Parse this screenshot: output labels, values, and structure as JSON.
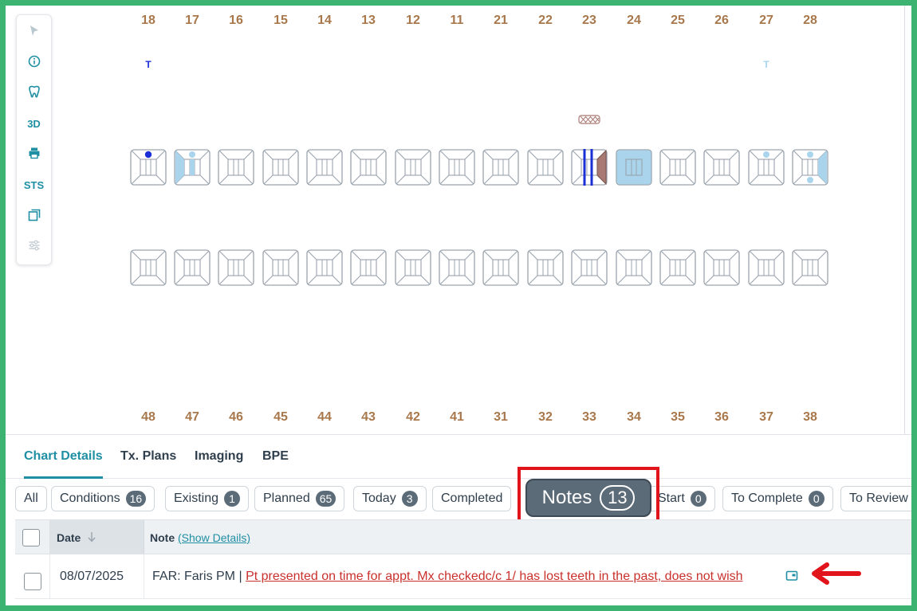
{
  "toolbar": {
    "items": [
      {
        "icon": "pointer-icon",
        "label": ""
      },
      {
        "icon": "info-icon",
        "label": ""
      },
      {
        "icon": "tooth-icon",
        "label": ""
      },
      {
        "icon": "3d-icon",
        "label": "3D"
      },
      {
        "icon": "print-icon",
        "label": ""
      },
      {
        "icon": "sts-icon",
        "label": "STS"
      },
      {
        "icon": "copy-icon",
        "label": ""
      },
      {
        "icon": "sliders-icon",
        "label": ""
      }
    ]
  },
  "chart": {
    "upper_numbers": [
      "18",
      "17",
      "16",
      "15",
      "14",
      "13",
      "12",
      "11",
      "21",
      "22",
      "23",
      "24",
      "25",
      "26",
      "27",
      "28"
    ],
    "lower_numbers": [
      "48",
      "47",
      "46",
      "45",
      "44",
      "43",
      "42",
      "41",
      "31",
      "32",
      "33",
      "34",
      "35",
      "36",
      "37",
      "38"
    ],
    "markers": [
      {
        "tooth": "18",
        "text": "T",
        "color": "#1a2fd6"
      },
      {
        "tooth": "27",
        "text": "T",
        "color": "#a9d4ec"
      }
    ],
    "colors": {
      "tooth_number": "#a8784c",
      "tooth_outline": "#9aa3ac",
      "surface_fill": "#a9d4ec",
      "crown": "#a97a73",
      "implant_lines": "#1a2fd6"
    }
  },
  "tabs": [
    {
      "label": "Chart Details",
      "active": true
    },
    {
      "label": "Tx. Plans",
      "active": false
    },
    {
      "label": "Imaging",
      "active": false
    },
    {
      "label": "BPE",
      "active": false
    }
  ],
  "filters": [
    {
      "label": "All",
      "count": ""
    },
    {
      "label": "Conditions",
      "count": "16"
    },
    {
      "label": "Existing",
      "count": "1"
    },
    {
      "label": "Planned",
      "count": "65"
    },
    {
      "label": "Today",
      "count": "3"
    },
    {
      "label": "Completed",
      "count": ""
    },
    {
      "label": "Start",
      "count": "0"
    },
    {
      "label": "To Complete",
      "count": "0"
    },
    {
      "label": "To Review",
      "count": ""
    }
  ],
  "notes_filter": {
    "label": "Notes",
    "count": "13"
  },
  "table": {
    "headers": {
      "date": "Date",
      "note": "Note",
      "show_details": "(Show Details)"
    },
    "rows": [
      {
        "date": "08/07/2025",
        "author": "FAR: Faris PM | ",
        "note": "Pt presented on time for appt. Mx checkedc/c 1/ has lost teeth in the past, does not wish"
      }
    ]
  },
  "annotation_color": "#e0141a"
}
